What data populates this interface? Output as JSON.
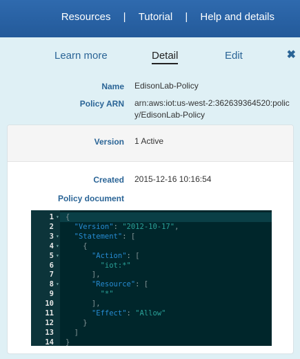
{
  "topnav": {
    "items": [
      "Resources",
      "Tutorial",
      "Help and details"
    ],
    "separator": "|"
  },
  "tabs": [
    {
      "label": "Learn more",
      "active": false
    },
    {
      "label": "Detail",
      "active": true
    },
    {
      "label": "Edit",
      "active": false
    }
  ],
  "close_icon": "close-icon",
  "fields": {
    "name_label": "Name",
    "name_value": "EdisonLab-Policy",
    "arn_label": "Policy ARN",
    "arn_value_line1": "arn:aws:iot:us-west-2:362639364520:polic",
    "arn_value_line2": "y/EdisonLab-Policy",
    "version_label": "Version",
    "version_value": "1 Active",
    "created_label": "Created",
    "created_value": "2015-12-16 10:16:54",
    "policy_document_label": "Policy document"
  },
  "code": {
    "line_numbers": [
      "1",
      "2",
      "3",
      "4",
      "5",
      "6",
      "7",
      "8",
      "9",
      "10",
      "11",
      "12",
      "13",
      "14"
    ],
    "lines": [
      "{",
      "  \"Version\": \"2012-10-17\",",
      "  \"Statement\": [",
      "    {",
      "      \"Action\": [",
      "        \"iot:*\"",
      "      ],",
      "      \"Resource\": [",
      "        \"*\"",
      "      ],",
      "      \"Effect\": \"Allow\"",
      "    }",
      "  ]",
      "}"
    ]
  },
  "colors": {
    "topbar": "#2f6aae",
    "panel_bg": "#dff0f5",
    "link": "#2a6496",
    "code_bg": "#00262b"
  }
}
